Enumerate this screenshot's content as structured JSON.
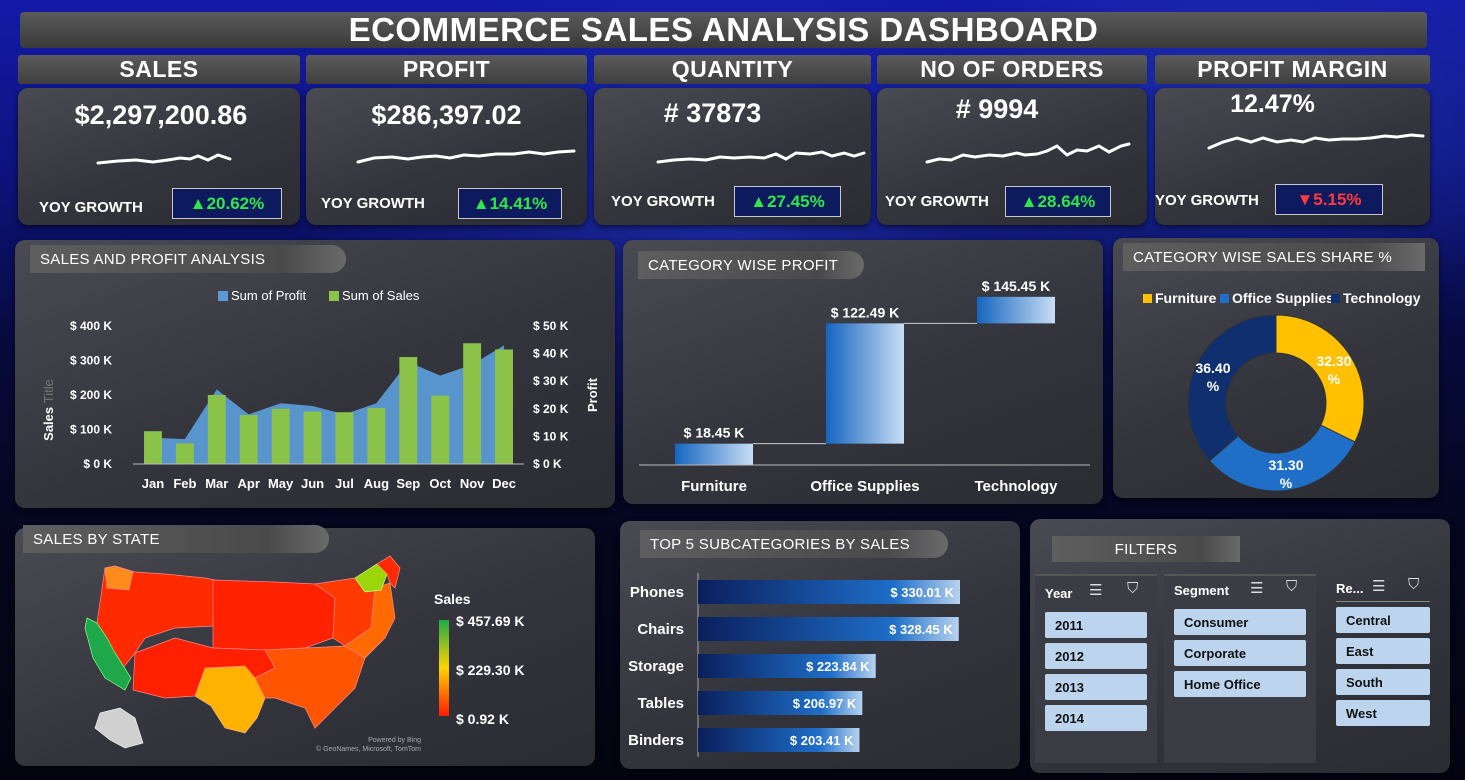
{
  "title": "ECOMMERCE SALES ANALYSIS DASHBOARD",
  "kpis": [
    {
      "label": "SALES",
      "value": "$2,297,200.86",
      "yoy_label": "YOY GROWTH",
      "yoy": "▲20.62%",
      "dir": "up"
    },
    {
      "label": "PROFIT",
      "value": "$286,397.02",
      "yoy_label": "YOY GROWTH",
      "yoy": "▲14.41%",
      "dir": "up"
    },
    {
      "label": "QUANTITY",
      "value": "# 37873",
      "yoy_label": "YOY GROWTH",
      "yoy": "▲27.45%",
      "dir": "up"
    },
    {
      "label": "NO OF ORDERS",
      "value": "# 9994",
      "yoy_label": "YOY GROWTH",
      "yoy": "▲28.64%",
      "dir": "up"
    },
    {
      "label": "PROFIT MARGIN",
      "value": "12.47%",
      "yoy_label": "YOY GROWTH",
      "yoy": "▼5.15%",
      "dir": "down"
    }
  ],
  "sections": {
    "sales_profit": "SALES AND PROFIT ANALYSIS",
    "category_profit": "CATEGORY WISE PROFIT",
    "category_share": "CATEGORY WISE SALES SHARE %",
    "sales_by_state": "SALES BY STATE",
    "top5": "TOP 5 SUBCATEGORIES BY SALES",
    "filters": "FILTERS"
  },
  "colors": {
    "profit": "#5b9bd5",
    "sales": "#8bc34a",
    "furniture": "#ffc000",
    "office": "#1f6fc9",
    "technology": "#0f2f6e",
    "yoy_up": "#2ee84a",
    "yoy_down": "#ff3b3b"
  },
  "map": {
    "legend_title": "Sales",
    "legend_max": "$ 457.69 K",
    "legend_mid": "$ 229.30 K",
    "legend_min": "$ 0.92 K",
    "credit_line1": "Powered by Bing",
    "credit_line2": "© GeoNames, Microsoft, TomTom"
  },
  "filters": {
    "year": {
      "title": "Year",
      "items": [
        "2011",
        "2012",
        "2013",
        "2014"
      ]
    },
    "segment": {
      "title": "Segment",
      "items": [
        "Consumer",
        "Corporate",
        "Home Office"
      ]
    },
    "region": {
      "title": "Re...",
      "items": [
        "Central",
        "East",
        "South",
        "West"
      ]
    }
  },
  "chart_data": [
    {
      "type": "bar",
      "title": "SALES AND PROFIT ANALYSIS",
      "categories": [
        "Jan",
        "Feb",
        "Mar",
        "Apr",
        "May",
        "Jun",
        "Jul",
        "Aug",
        "Sep",
        "Oct",
        "Nov",
        "Dec"
      ],
      "series": [
        {
          "name": "Sum of Profit",
          "type": "area",
          "axis": "right",
          "values": [
            9500,
            9000,
            27000,
            18000,
            22000,
            21000,
            18000,
            22000,
            37000,
            32000,
            36000,
            43000
          ]
        },
        {
          "name": "Sum of Sales",
          "type": "bar",
          "axis": "left",
          "values": [
            95000,
            60000,
            200000,
            142000,
            160000,
            152000,
            150000,
            162000,
            310000,
            198000,
            350000,
            332000
          ]
        }
      ],
      "ylabel": "Sales",
      "ylabel_hint": "Title",
      "y2label": "Profit",
      "ylim": [
        0,
        400000
      ],
      "y2lim": [
        0,
        50000
      ],
      "yticks": [
        "$ 0 K",
        "$ 100 K",
        "$ 200 K",
        "$ 300 K",
        "$ 400 K"
      ],
      "y2ticks": [
        "$ 0 K",
        "$ 10 K",
        "$ 20 K",
        "$ 30 K",
        "$ 40 K",
        "$ 50 K"
      ],
      "legend": "top"
    },
    {
      "type": "bar",
      "subtype": "waterfall",
      "title": "CATEGORY WISE PROFIT",
      "categories": [
        "Furniture",
        "Office Supplies",
        "Technology"
      ],
      "values": [
        18.45,
        104.04,
        22.96
      ],
      "cumulative": [
        18.45,
        122.49,
        145.45
      ],
      "labels": [
        "$ 18.45 K",
        "$ 122.49 K",
        "$ 145.45 K"
      ],
      "ylim": [
        0,
        160
      ]
    },
    {
      "type": "pie",
      "subtype": "donut",
      "title": "CATEGORY WISE SALES SHARE %",
      "categories": [
        "Furniture",
        "Office Supplies",
        "Technology"
      ],
      "values": [
        32.3,
        31.3,
        36.4
      ],
      "labels": [
        "32.30 %",
        "31.30 %",
        "36.40 %"
      ],
      "legend": "top"
    },
    {
      "type": "bar",
      "orientation": "horizontal",
      "title": "TOP 5 SUBCATEGORIES BY SALES",
      "categories": [
        "Phones",
        "Chairs",
        "Storage",
        "Tables",
        "Binders"
      ],
      "values": [
        330.01,
        328.45,
        223.84,
        206.97,
        203.41
      ],
      "labels": [
        "$ 330.01 K",
        "$ 328.45 K",
        "$ 223.84 K",
        "$ 206.97 K",
        "$ 203.41 K"
      ]
    }
  ]
}
